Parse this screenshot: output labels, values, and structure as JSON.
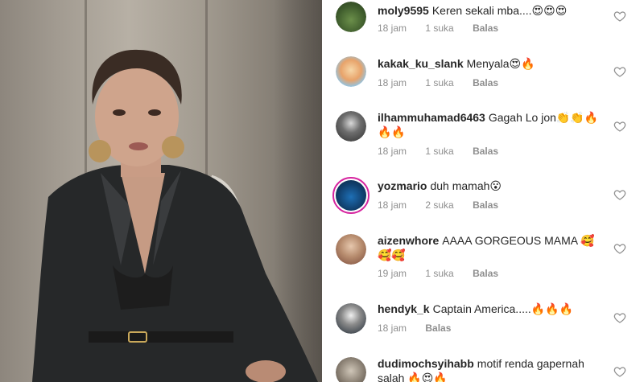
{
  "colors": {
    "meta_text": "#8e8e8e",
    "story_ring": "#d6249f",
    "text": "#262626"
  },
  "comments": [
    {
      "username": "moly9595",
      "text": "Keren sekali mba....😍😍😍",
      "time": "18 jam",
      "likes": "1 suka",
      "reply": "Balas",
      "avatar": "landscape-avatar"
    },
    {
      "username": "kakak_ku_slank",
      "text": "Menyala😍🔥",
      "time": "18 jam",
      "likes": "1 suka",
      "reply": "Balas",
      "avatar": "cartoon-avatar"
    },
    {
      "username": "ilhammuhamad6463",
      "text": "Gagah Lo jon👏👏🔥🔥🔥",
      "time": "18 jam",
      "likes": "1 suka",
      "reply": "Balas",
      "avatar": "masked-person-avatar"
    },
    {
      "username": "yozmario",
      "text": "duh mamah😮",
      "time": "18 jam",
      "likes": "2 suka",
      "reply": "Balas",
      "avatar": "blue-scene-avatar"
    },
    {
      "username": "aizenwhore",
      "text": "AAAA GORGEOUS MAMA 🥰🥰🥰",
      "time": "19 jam",
      "likes": "1 suka",
      "reply": "Balas",
      "avatar": "woman-avatar"
    },
    {
      "username": "hendyk_k",
      "text": "Captain America.....🔥🔥🔥",
      "time": "18 jam",
      "likes": "",
      "reply": "Balas",
      "avatar": "masked-man-avatar"
    },
    {
      "username": "dudimochsyihabb",
      "text": "motif renda gapernah salah 🔥😍🔥",
      "time": "",
      "likes": "",
      "reply": "",
      "avatar": "group-avatar"
    }
  ]
}
